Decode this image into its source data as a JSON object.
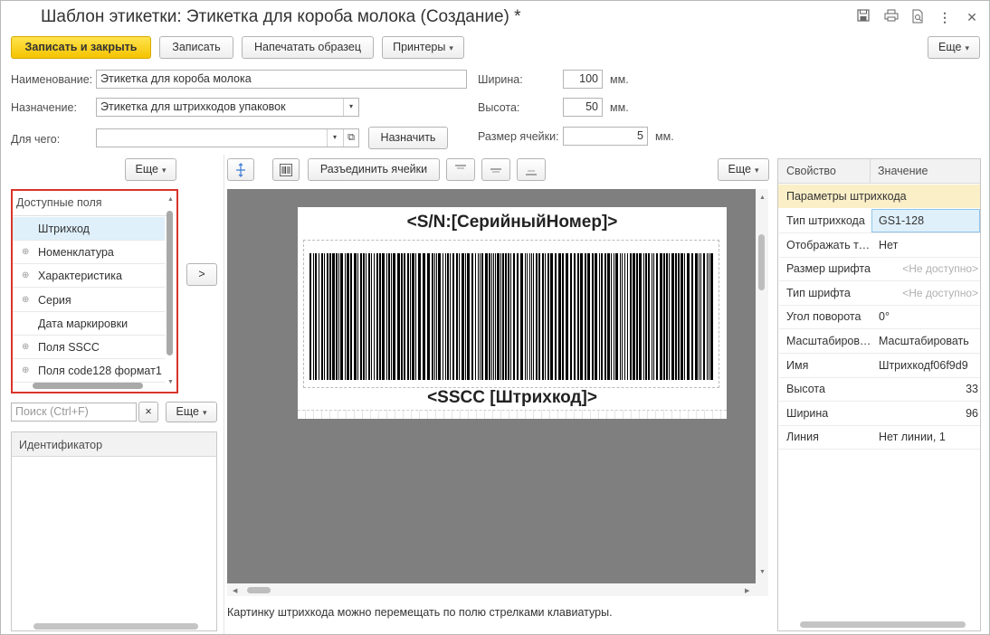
{
  "window": {
    "title": "Шаблон этикетки: Этикетка для короба молока (Создание) *",
    "icons": [
      "save-icon",
      "print-icon",
      "preview-icon",
      "more-vert-icon",
      "close-icon"
    ]
  },
  "toolbar": {
    "save_close": "Записать и закрыть",
    "save": "Записать",
    "print_sample": "Напечатать образец",
    "printers": "Принтеры",
    "more": "Еще"
  },
  "form": {
    "name_label": "Наименование:",
    "name_value": "Этикетка для короба молока",
    "purpose_label": "Назначение:",
    "purpose_value": "Этикетка для штрихкодов упаковок",
    "for_what_label": "Для чего:",
    "for_what_value": "",
    "assign_button": "Назначить",
    "width_label": "Ширина:",
    "width_value": "100",
    "width_unit": "мм.",
    "height_label": "Высота:",
    "height_value": "50",
    "height_unit": "мм.",
    "cell_label": "Размер ячейки:",
    "cell_value": "5",
    "cell_unit": "мм."
  },
  "left_panel": {
    "more": "Еще",
    "header": "Доступные поля",
    "items": [
      {
        "label": "Штрихкод",
        "expandable": false,
        "selected": true
      },
      {
        "label": "Номенклатура",
        "expandable": true
      },
      {
        "label": "Характеристика",
        "expandable": true
      },
      {
        "label": "Серия",
        "expandable": true
      },
      {
        "label": "Дата маркировки",
        "expandable": false
      },
      {
        "label": "Поля SSCC",
        "expandable": true
      },
      {
        "label": "Поля code128 формат1",
        "expandable": true
      }
    ],
    "move_button": ">",
    "search_placeholder": "Поиск (Ctrl+F)",
    "search_clear": "×",
    "search_more": "Еще",
    "id_header": "Идентификатор"
  },
  "center": {
    "split_cells": "Разъединить ячейки",
    "more": "Еще",
    "label_top_text": "<S/N:[СерийныйНомер]>",
    "label_bottom_text": "<SSCC [Штрихкод]>",
    "hint": "Картинку штрихкода можно перемещать по полю стрелками клавиатуры."
  },
  "properties": {
    "col_property": "Свойство",
    "col_value": "Значение",
    "group": "Параметры штрихкода",
    "rows": [
      {
        "key": "Тип штрихкода",
        "value": "GS1-128"
      },
      {
        "key": "Отображать текст",
        "value": "Нет"
      },
      {
        "key": "Размер шрифта",
        "value": "<Не доступно>"
      },
      {
        "key": "Тип шрифта",
        "value": "<Не доступно>"
      },
      {
        "key": "Угол поворота",
        "value": "0°"
      },
      {
        "key": "Масштабирование",
        "value": "Масштабировать"
      },
      {
        "key": "Имя",
        "value": "Штрихкодf06f9d9"
      },
      {
        "key": "Высота",
        "value": "33"
      },
      {
        "key": "Ширина",
        "value": "96"
      },
      {
        "key": "Линия",
        "value": "Нет линии, 1"
      }
    ]
  },
  "colors": {
    "accent": "#f5c300",
    "highlight": "#d9352b",
    "group_bg": "#fbefc8",
    "selected_bg": "#dff0fb",
    "canvas_bg": "#7f7f7f"
  }
}
